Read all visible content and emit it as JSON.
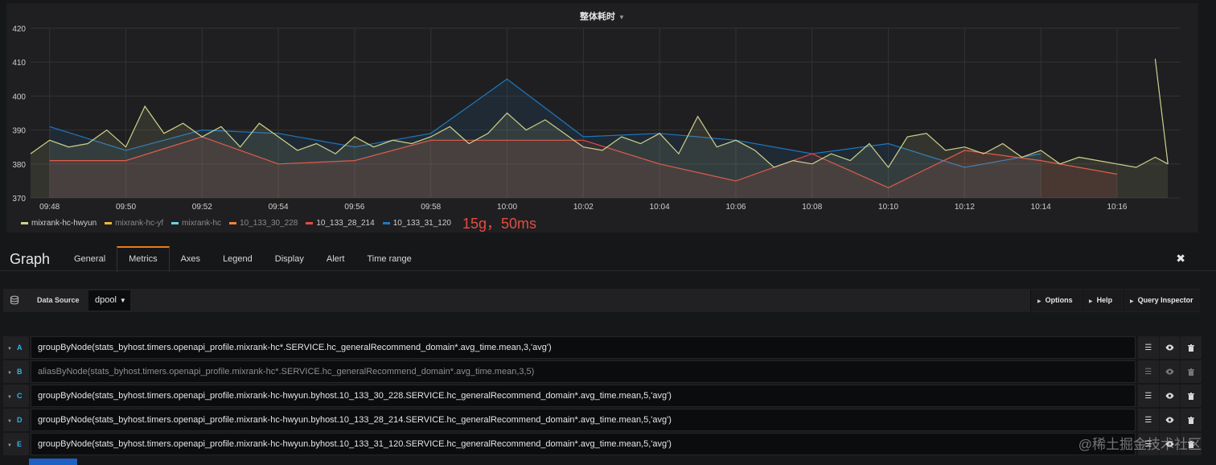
{
  "panel": {
    "title": "整体耗时",
    "annotation": "15g，50ms"
  },
  "chart_data": {
    "type": "line",
    "title": "整体耗时",
    "ylim": [
      370,
      420
    ],
    "yticks": [
      370,
      380,
      390,
      400,
      410,
      420
    ],
    "xlim": [
      "09:47:30",
      "10:17:40"
    ],
    "xticks": [
      "09:48",
      "09:50",
      "09:52",
      "09:54",
      "09:56",
      "09:58",
      "10:00",
      "10:02",
      "10:04",
      "10:06",
      "10:08",
      "10:10",
      "10:12",
      "10:14",
      "10:16"
    ],
    "grid": true,
    "legend_position": "bottom-left",
    "series": [
      {
        "name": "mixrank-hc-hwyun",
        "color": "#cfd18b",
        "x": [
          "09:47:30",
          "09:48:00",
          "09:48:30",
          "09:49:00",
          "09:49:30",
          "09:50:00",
          "09:50:30",
          "09:51:00",
          "09:51:30",
          "09:52:00",
          "09:52:30",
          "09:53:00",
          "09:53:30",
          "09:54:00",
          "09:54:30",
          "09:55:00",
          "09:55:30",
          "09:56:00",
          "09:56:30",
          "09:57:00",
          "09:57:30",
          "09:58:00",
          "09:58:30",
          "09:59:00",
          "09:59:30",
          "10:00:00",
          "10:00:30",
          "10:01:00",
          "10:01:30",
          "10:02:00",
          "10:02:30",
          "10:03:00",
          "10:03:30",
          "10:04:00",
          "10:04:30",
          "10:05:00",
          "10:05:30",
          "10:06:00",
          "10:06:30",
          "10:07:00",
          "10:07:30",
          "10:08:00",
          "10:08:30",
          "10:09:00",
          "10:09:30",
          "10:10:00",
          "10:10:30",
          "10:11:00",
          "10:11:30",
          "10:12:00",
          "10:12:30",
          "10:13:00",
          "10:13:30",
          "10:14:00",
          "10:14:30",
          "10:15:00",
          "10:15:30",
          "10:16:00",
          "10:16:30",
          "10:17:00",
          "10:17:20"
        ],
        "values": [
          383,
          387,
          385,
          386,
          390,
          385,
          397,
          389,
          392,
          388,
          391,
          385,
          392,
          388,
          384,
          386,
          383,
          388,
          385,
          387,
          386,
          388,
          391,
          386,
          389,
          395,
          390,
          393,
          389,
          385,
          384,
          388,
          386,
          389,
          383,
          394,
          385,
          387,
          384,
          379,
          381,
          380,
          383,
          381,
          386,
          379,
          388,
          389,
          384,
          385,
          383,
          386,
          382,
          384,
          380,
          382,
          381,
          380,
          379,
          382,
          380
        ]
      },
      {
        "name": "mixrank-hc-yf",
        "color": "#eab839",
        "x": [],
        "values": []
      },
      {
        "name": "mixrank-hc",
        "color": "#6ed0e0",
        "x": [],
        "values": []
      },
      {
        "name": "10_133_30_228",
        "color": "#ef843c",
        "x": [],
        "values": []
      },
      {
        "name": "10_133_28_214",
        "color": "#e24d42",
        "x": [
          "09:48:00",
          "09:50:00",
          "09:52:00",
          "09:54:00",
          "09:56:00",
          "09:58:00",
          "10:00:00",
          "10:02:00",
          "10:04:00",
          "10:06:00",
          "10:08:00",
          "10:10:00",
          "10:12:00",
          "10:14:00",
          "10:16:00"
        ],
        "values": [
          381,
          381,
          388,
          380,
          381,
          387,
          387,
          387,
          380,
          375,
          383,
          373,
          384,
          381,
          377
        ]
      },
      {
        "name": "10_133_31_120",
        "color": "#1f78c1",
        "x": [
          "09:48:00",
          "09:50:00",
          "09:52:00",
          "09:54:00",
          "09:56:00",
          "09:58:00",
          "10:00:00",
          "10:02:00",
          "10:04:00",
          "10:06:00",
          "10:08:00",
          "10:10:00",
          "10:12:00",
          "10:14:00"
        ],
        "values": [
          391,
          384,
          390,
          389,
          385,
          389,
          405,
          388,
          389,
          387,
          383,
          386,
          379,
          383
        ]
      }
    ],
    "spike": {
      "x": "10:17:00",
      "value": 411
    }
  },
  "editor": {
    "title": "Graph",
    "tabs": [
      "General",
      "Metrics",
      "Axes",
      "Legend",
      "Display",
      "Alert",
      "Time range"
    ],
    "active_tab": "Metrics",
    "close_label": "✖"
  },
  "datasource": {
    "label": "Data Source",
    "value": "dpool",
    "buttons": [
      "Options",
      "Help",
      "Query Inspector"
    ]
  },
  "queries": [
    {
      "ref": "A",
      "text": "groupByNode(stats_byhost.timers.openapi_profile.mixrank-hc*.SERVICE.hc_generalRecommend_domain*.avg_time.mean,3,'avg')",
      "disabled": false
    },
    {
      "ref": "B",
      "text": "aliasByNode(stats_byhost.timers.openapi_profile.mixrank-hc*.SERVICE.hc_generalRecommend_domain*.avg_time.mean,3,5)",
      "disabled": true
    },
    {
      "ref": "C",
      "text": "groupByNode(stats_byhost.timers.openapi_profile.mixrank-hc-hwyun.byhost.10_133_30_228.SERVICE.hc_generalRecommend_domain*.avg_time.mean,5,'avg')",
      "disabled": false
    },
    {
      "ref": "D",
      "text": "groupByNode(stats_byhost.timers.openapi_profile.mixrank-hc-hwyun.byhost.10_133_28_214.SERVICE.hc_generalRecommend_domain*.avg_time.mean,5,'avg')",
      "disabled": false
    },
    {
      "ref": "E",
      "text": "groupByNode(stats_byhost.timers.openapi_profile.mixrank-hc-hwyun.byhost.10_133_31_120.SERVICE.hc_generalRecommend_domain*.avg_time.mean,5,'avg')",
      "disabled": false
    }
  ],
  "watermark": "@稀土掘金技术社区",
  "colors": {
    "background": "#161719",
    "panel": "#1f1f21",
    "accent_tab": "#eb7b18",
    "query_letter": "#33b5e5"
  }
}
